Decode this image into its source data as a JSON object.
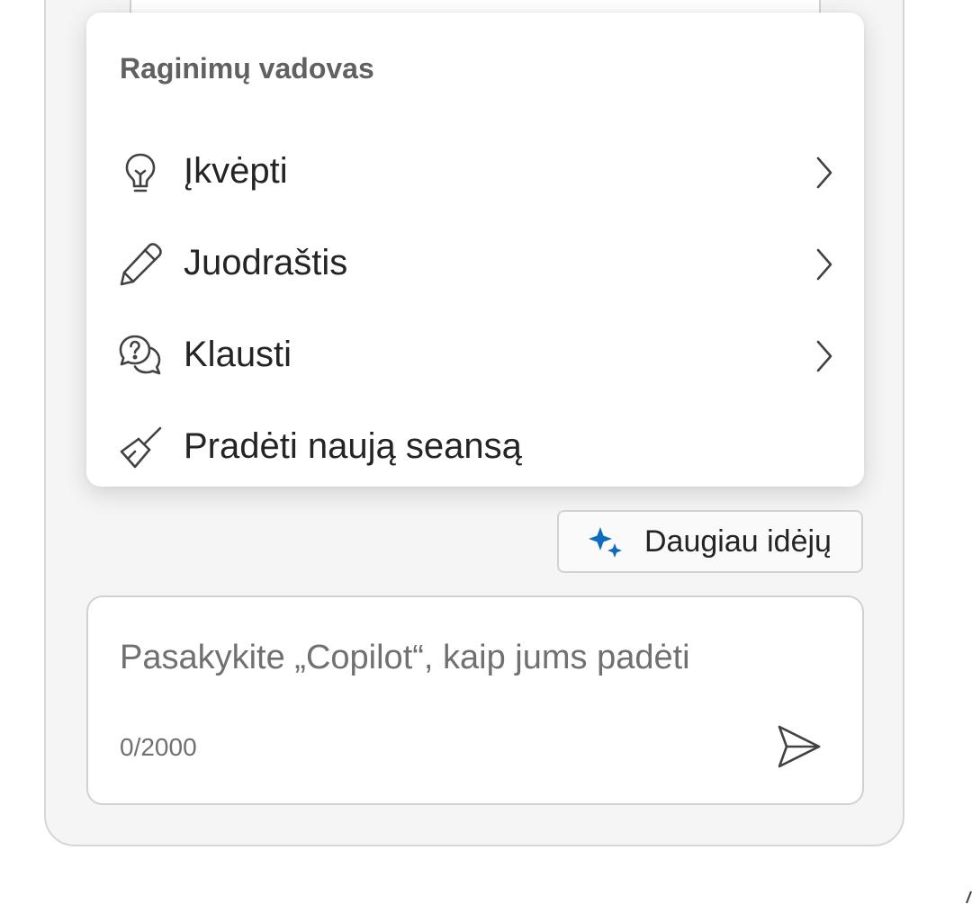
{
  "menu": {
    "header": "Raginimų vadovas",
    "items": [
      {
        "label": "Įkvėpti",
        "icon": "lightbulb-icon",
        "has_submenu": true
      },
      {
        "label": "Juodraštis",
        "icon": "pencil-icon",
        "has_submenu": true
      },
      {
        "label": "Klausti",
        "icon": "chat-question-icon",
        "has_submenu": true
      },
      {
        "label": "Pradėti naują seansą",
        "icon": "broom-icon",
        "has_submenu": false
      }
    ]
  },
  "ideas_button": {
    "label": "Daugiau idėjų",
    "icon": "sparkle-icon"
  },
  "composer": {
    "placeholder": "Pasakykite „Copilot“, kaip jums padėti",
    "counter": "0/2000",
    "send_icon": "send-icon"
  },
  "colors": {
    "pane_bg": "#f5f5f5",
    "sparkle_accent": "#0f6cbd",
    "text_primary": "#242424",
    "text_secondary": "#707070"
  }
}
